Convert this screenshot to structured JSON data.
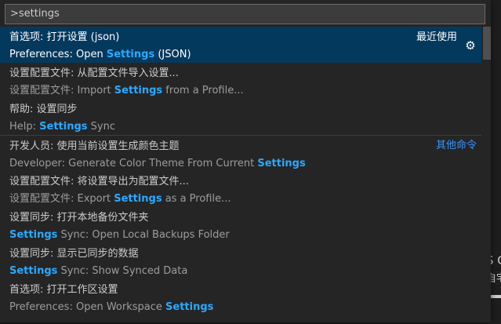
{
  "background": {
    "right_text_1": "S C",
    "right_text_2": "自宅",
    "badge_text": "★"
  },
  "search": {
    "value": ">settings"
  },
  "items": [
    {
      "line1": "首选项: 打开设置 (json)",
      "line2_pre": "Preferences: Open ",
      "line2_hl": "Settings",
      "line2_post": " (JSON)",
      "tag": "最近使用"
    },
    {
      "line1": "设置配置文件: 从配置文件导入设置...",
      "line2_pre": "设置配置文件: Import ",
      "line2_hl": "Settings",
      "line2_post": " from a Profile..."
    },
    {
      "line1": "帮助: 设置同步",
      "line2_pre": "Help: ",
      "line2_hl": "Settings",
      "line2_post": " Sync"
    },
    {
      "line1": "开发人员: 使用当前设置生成颜色主题",
      "line2_pre": "Developer: Generate Color Theme From Current ",
      "line2_hl": "Settings",
      "line2_post": "",
      "tag": "其他命令"
    },
    {
      "line1": "设置配置文件: 将设置导出为配置文件...",
      "line2_pre": "设置配置文件: Export ",
      "line2_hl": "Settings",
      "line2_post": " as a Profile..."
    },
    {
      "line1": "设置同步: 打开本地备份文件夹",
      "line2_pre": "",
      "line2_hl": "Settings",
      "line2_post": " Sync: Open Local Backups Folder"
    },
    {
      "line1": "设置同步: 显示已同步的数据",
      "line2_pre": "",
      "line2_hl": "Settings",
      "line2_post": " Sync: Show Synced Data"
    },
    {
      "line1": "首选项: 打开工作区设置",
      "line2_pre": "Preferences: Open Workspace ",
      "line2_hl": "Settings",
      "line2_post": ""
    }
  ],
  "colors": {
    "accent": "#2aaaff",
    "selection": "#04395e",
    "link": "#3794ff"
  },
  "icons": {
    "gear": "gear-icon"
  }
}
